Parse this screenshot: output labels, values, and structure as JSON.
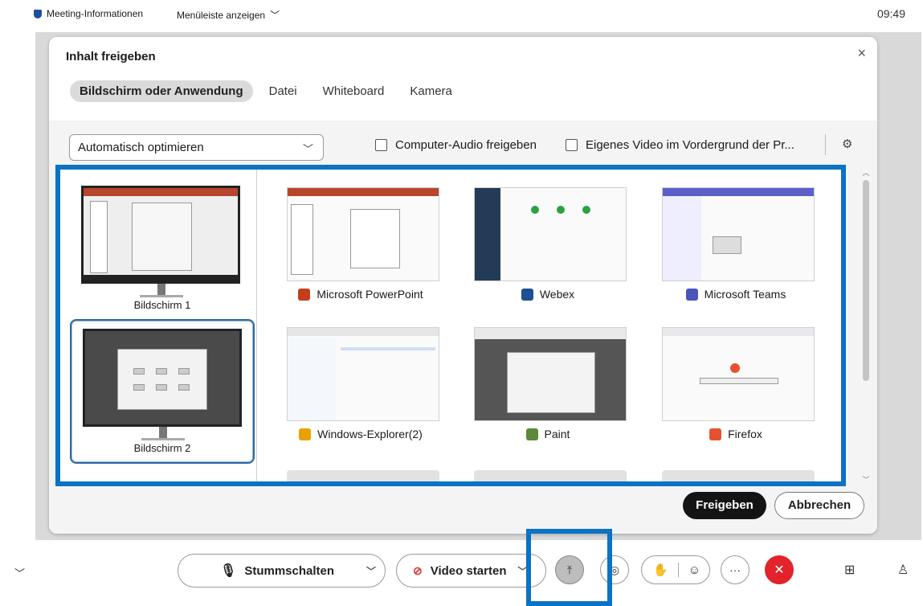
{
  "topbar": {
    "meeting_info": "Meeting-Informationen",
    "menu_label": "Menüleiste anzeigen",
    "time": "09:49"
  },
  "dialog": {
    "title": "Inhalt freigeben",
    "close": "×",
    "tabs": [
      {
        "label": "Bildschirm oder Anwendung",
        "active": true
      },
      {
        "label": "Datei",
        "active": false
      },
      {
        "label": "Whiteboard",
        "active": false
      },
      {
        "label": "Kamera",
        "active": false
      }
    ],
    "optimize_select": "Automatisch optimieren",
    "checkbox_audio": "Computer-Audio freigeben",
    "checkbox_video": "Eigenes Video im Vordergrund der Pr...",
    "screens": [
      {
        "label": "Bildschirm 1",
        "selected": false
      },
      {
        "label": "Bildschirm 2",
        "selected": true
      }
    ],
    "apps": [
      {
        "label": "Microsoft PowerPoint",
        "icon": "powerpoint-icon",
        "color": "#c43e1c"
      },
      {
        "label": "Webex",
        "icon": "webex-icon",
        "color": "#1d4f91"
      },
      {
        "label": "Microsoft Teams",
        "icon": "teams-icon",
        "color": "#4b53bc"
      },
      {
        "label": "Windows-Explorer(2)",
        "icon": "explorer-icon",
        "color": "#e8a200"
      },
      {
        "label": "Paint",
        "icon": "paint-icon",
        "color": "#5a8a3a"
      },
      {
        "label": "Firefox",
        "icon": "firefox-icon",
        "color": "#e8512d"
      }
    ],
    "share_button": "Freigeben",
    "cancel_button": "Abbrechen"
  },
  "bottombar": {
    "mute_label": "Stummschalten",
    "video_label": "Video starten"
  },
  "colors": {
    "highlight": "#0b72c4",
    "end_call": "#e2232b"
  }
}
